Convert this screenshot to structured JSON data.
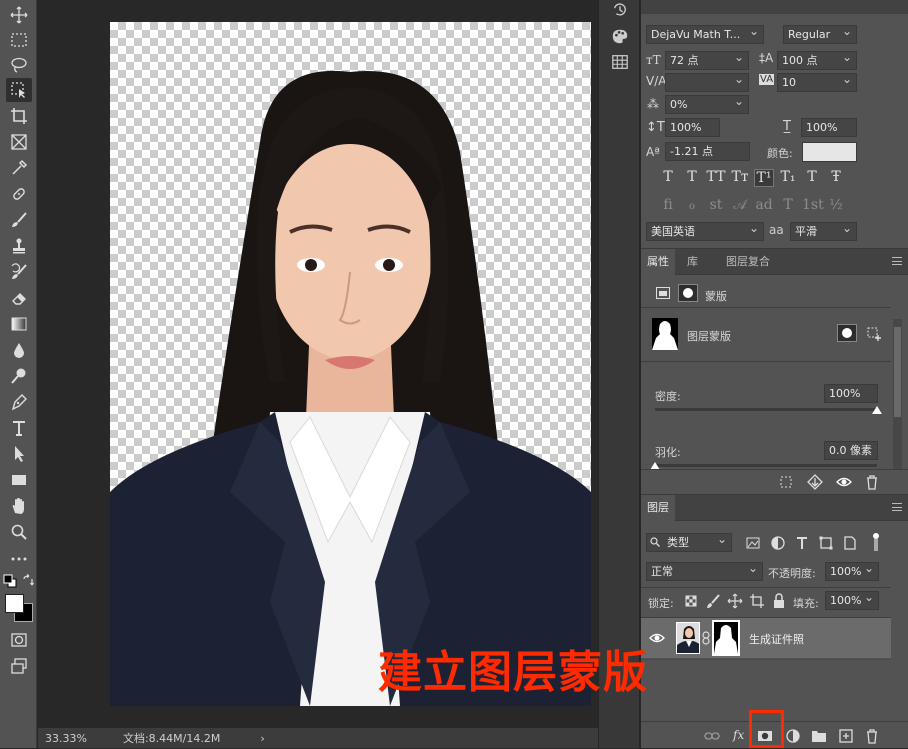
{
  "toolbar": {
    "tools": [
      "move-tool",
      "marquee-tool",
      "lasso-tool",
      "object-select-tool",
      "crop-tool",
      "frame-tool",
      "eyedropper-tool",
      "healing-brush-tool",
      "brush-tool",
      "clone-stamp-tool",
      "history-brush-tool",
      "eraser-tool",
      "gradient-tool",
      "blur-tool",
      "dodge-tool",
      "pen-tool",
      "type-tool",
      "path-select-tool",
      "rectangle-tool",
      "hand-tool",
      "zoom-tool",
      "more-tools",
      "swap-colors",
      "color-swatches",
      "quick-mask",
      "screen-mode"
    ]
  },
  "status": {
    "zoom": "33.33%",
    "doc_info": "文档:8.44M/14.2M",
    "arrow": "›"
  },
  "character": {
    "font_family": "DejaVu Math T...",
    "font_style": "Regular",
    "font_size": "72 点",
    "leading": "100 点",
    "kerning": "",
    "tracking": "10",
    "tsume": "0%",
    "vertical_scale": "100%",
    "horizontal_scale": "100%",
    "baseline_shift": "-1.21 点",
    "color_label": "颜色:",
    "color_swatch": "#e6e6e6",
    "style_glyphs": [
      "T",
      "T",
      "TT",
      "Tт",
      "T¹",
      "T₁",
      "T",
      "Ŧ"
    ],
    "opentype_glyphs": [
      "ﬁ",
      "ℴ",
      "st",
      "𝒜",
      "ad",
      "T",
      "1st",
      "½"
    ],
    "language": "美国英语",
    "aa_icon": "aa",
    "antialias": "平滑"
  },
  "properties": {
    "tabs": [
      "属性",
      "库",
      "图层复合"
    ],
    "mask_header": "蒙版",
    "layer_mask_label": "图层蒙版",
    "density_label": "密度:",
    "density_value": "100%",
    "density_level": 1.0,
    "feather_label": "羽化:",
    "feather_value": "0.0 像素",
    "feather_level": 0.0
  },
  "layers": {
    "tab": "图层",
    "filter_kind": "类型",
    "blend_mode": "正常",
    "opacity_label": "不透明度:",
    "opacity_value": "100%",
    "lock_label": "锁定:",
    "fill_label": "填充:",
    "fill_value": "100%",
    "layer_name": "生成证件照",
    "fx_label": "fx"
  },
  "annotation": {
    "text": "建立图层蒙版",
    "color": "#ff2a00"
  },
  "colors": {
    "panel_bg": "#535353",
    "canvas_bg": "#282828",
    "suit": "#1c2233",
    "shirt": "#f4f4f4"
  }
}
